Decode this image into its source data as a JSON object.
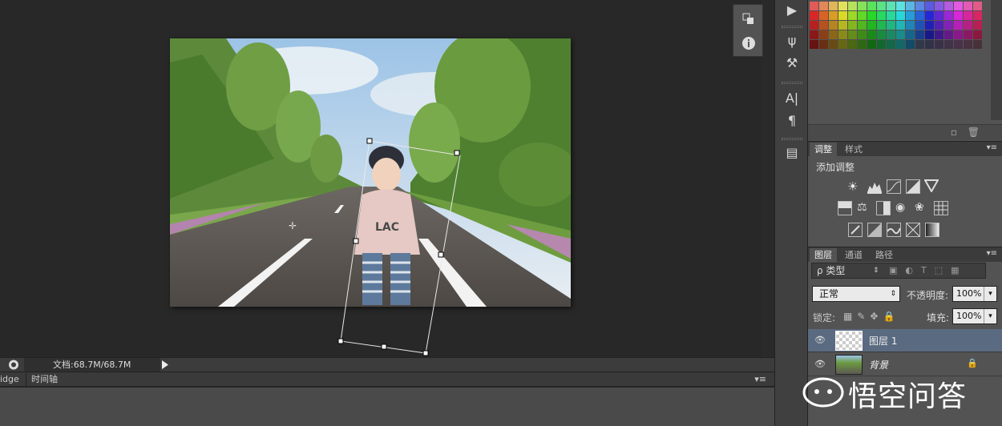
{
  "status": {
    "doc_info": "文档:68.7M/68.7M"
  },
  "bottom_tabs": [
    "idge",
    "时间轴"
  ],
  "adjustments": {
    "tabs": [
      "调整",
      "样式"
    ],
    "title": "添加调整"
  },
  "layers": {
    "tabs": [
      "图层",
      "通道",
      "路径"
    ],
    "filter_label": "ρ 类型",
    "blend_mode": "正常",
    "opacity_label": "不透明度:",
    "opacity_value": "100%",
    "lock_label": "锁定:",
    "fill_label": "填充:",
    "fill_value": "100%",
    "items": [
      {
        "name": "图层 1"
      },
      {
        "name": "背景"
      }
    ]
  },
  "watermark": {
    "text": "悟空问答"
  },
  "colors": {
    "selected_layer": "#5a6a80",
    "panel": "#535353",
    "background": "#282828"
  }
}
